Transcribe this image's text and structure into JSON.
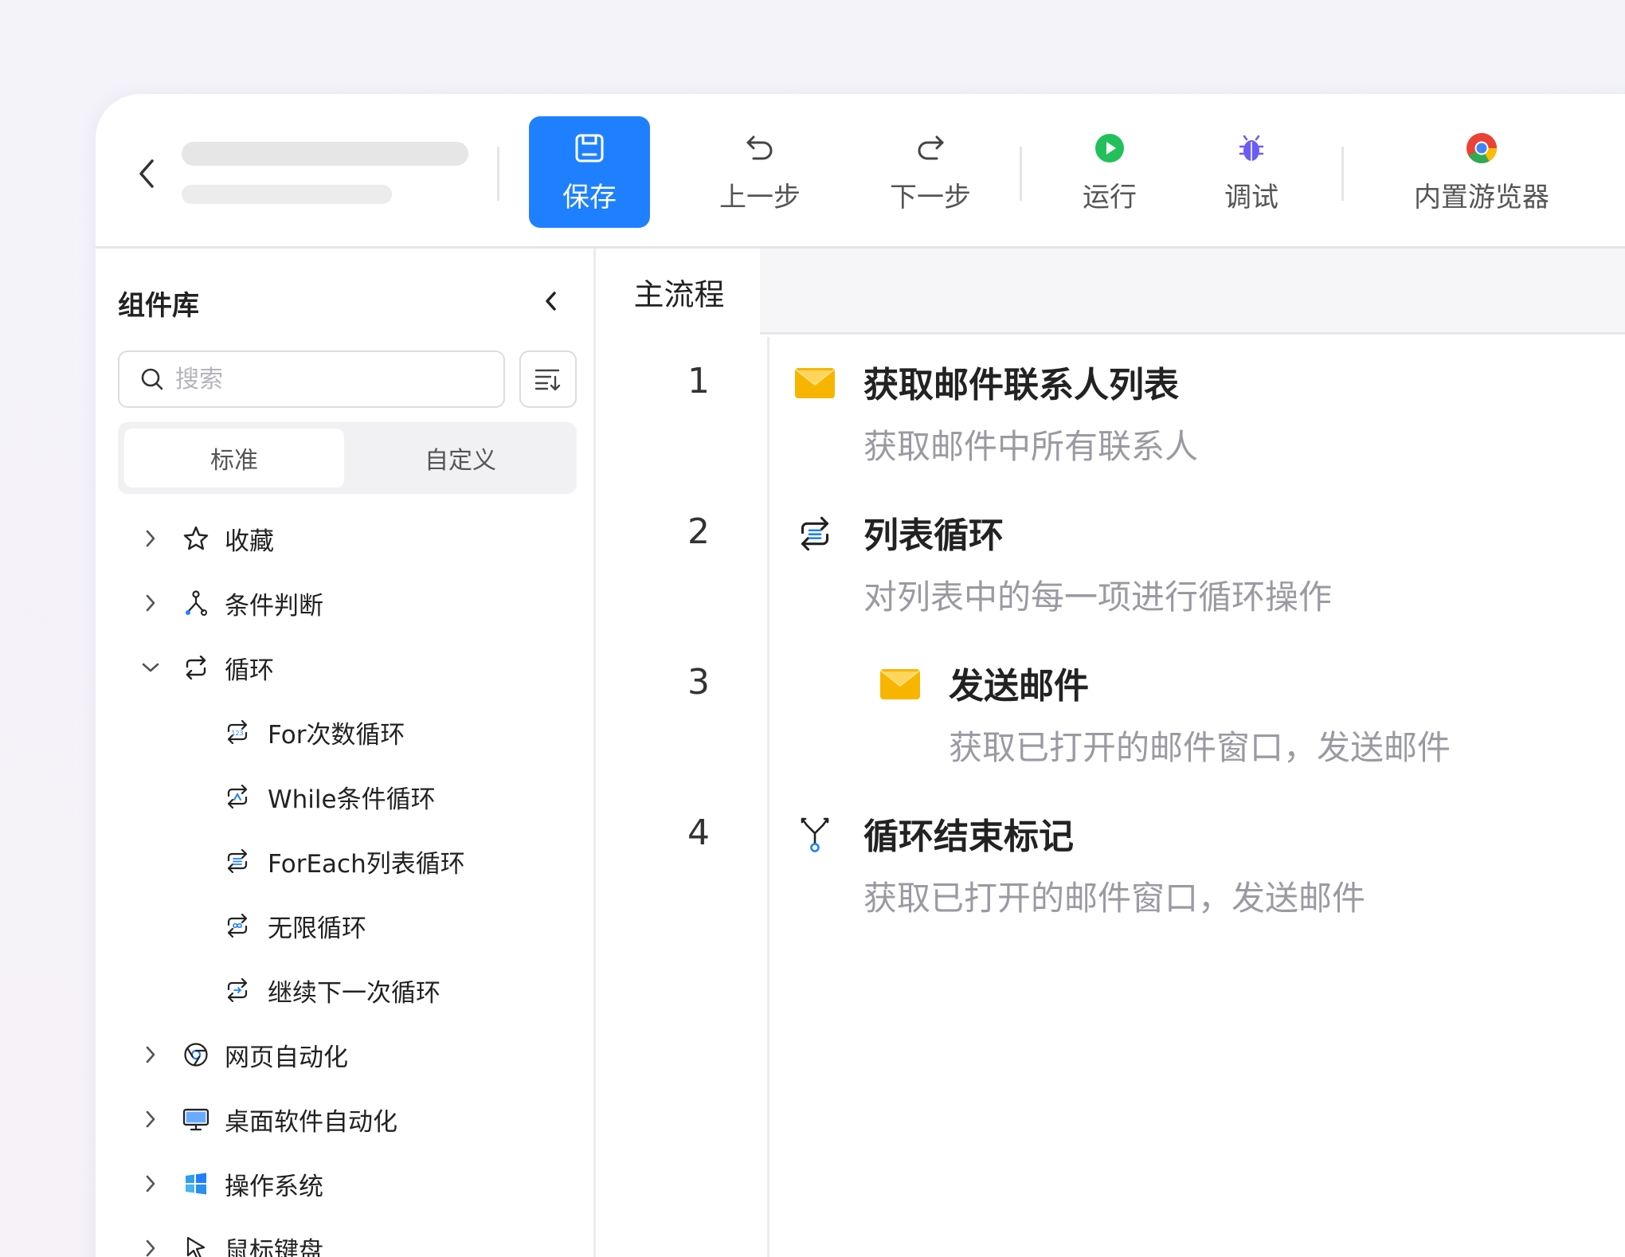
{
  "toolbar": {
    "save": "保存",
    "undo": "上一步",
    "redo": "下一步",
    "run": "运行",
    "debug": "调试",
    "browser": "内置游览器"
  },
  "sidebar": {
    "title": "组件库",
    "search_placeholder": "搜索",
    "tabs": [
      "标准",
      "自定义"
    ],
    "items": [
      {
        "label": "收藏",
        "icon": "star-icon"
      },
      {
        "label": "条件判断",
        "icon": "branch-icon"
      },
      {
        "label": "循环",
        "icon": "loop-icon",
        "expanded": true
      },
      {
        "label": "For次数循环",
        "icon": "loop-count-icon",
        "child": true
      },
      {
        "label": "While条件循环",
        "icon": "loop-while-icon",
        "child": true
      },
      {
        "label": "ForEach列表循环",
        "icon": "loop-list-icon",
        "child": true
      },
      {
        "label": "无限循环",
        "icon": "loop-infinite-icon",
        "child": true
      },
      {
        "label": "继续下一次循环",
        "icon": "loop-continue-icon",
        "child": true
      },
      {
        "label": "网页自动化",
        "icon": "chrome-icon"
      },
      {
        "label": "桌面软件自动化",
        "icon": "monitor-icon"
      },
      {
        "label": "操作系统",
        "icon": "windows-icon"
      },
      {
        "label": "鼠标键盘",
        "icon": "cursor-icon"
      }
    ]
  },
  "main": {
    "tab": "主流程",
    "steps": [
      {
        "num": "1",
        "title": "获取邮件联系人列表",
        "desc": "获取邮件中所有联系人",
        "icon": "envelope-icon"
      },
      {
        "num": "2",
        "title": "列表循环",
        "desc": "对列表中的每一项进行循环操作",
        "icon": "loop-list-icon"
      },
      {
        "num": "3",
        "title": "发送邮件",
        "desc": "获取已打开的邮件窗口，发送邮件",
        "icon": "envelope-icon"
      },
      {
        "num": "4",
        "title": "循环结束标记",
        "desc": "获取已打开的邮件窗口，发送邮件",
        "icon": "loop-end-icon"
      }
    ]
  },
  "colors": {
    "accent": "#1f80ff",
    "run": "#22c05a",
    "debug": "#6b5cf6",
    "mail": "#f7b500"
  }
}
